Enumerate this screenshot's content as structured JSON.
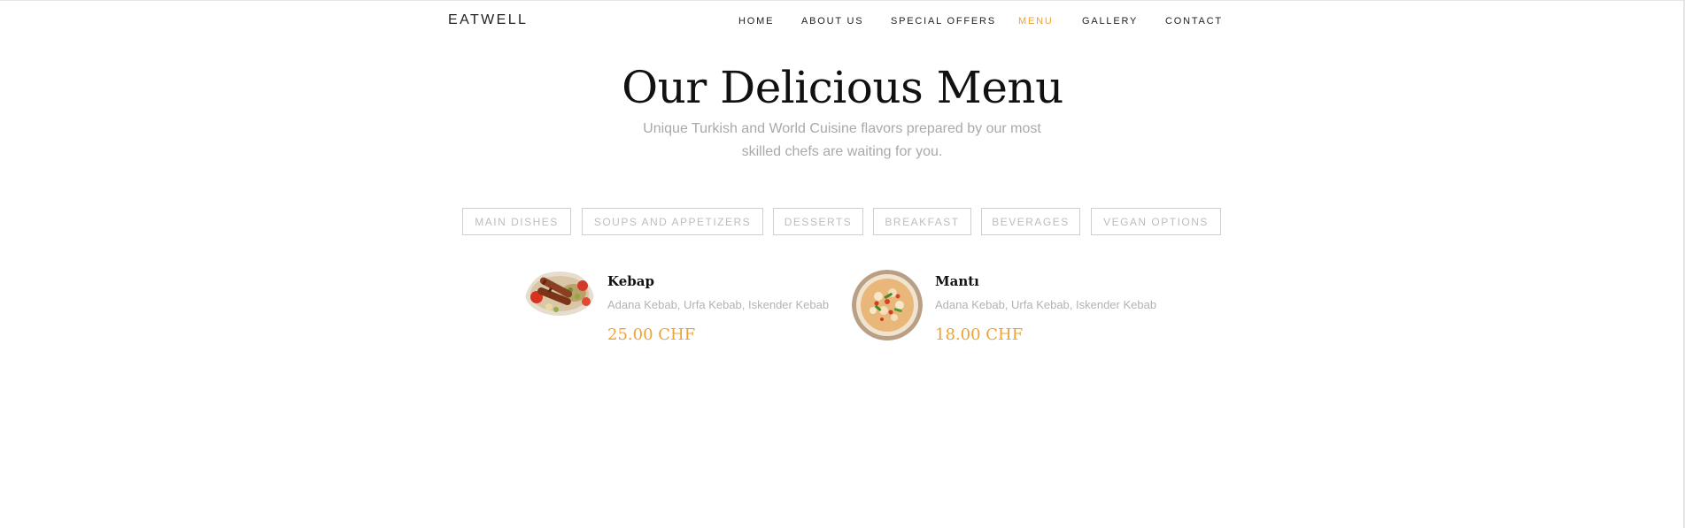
{
  "brand": "EATWELL",
  "nav": [
    {
      "label": "HOME",
      "active": false
    },
    {
      "label": "ABOUT US",
      "active": false
    },
    {
      "label": "SPECIAL OFFERS",
      "active": false
    },
    {
      "label": "MENU",
      "active": true
    },
    {
      "label": "GALLERY",
      "active": false
    },
    {
      "label": "CONTACT",
      "active": false
    }
  ],
  "hero": {
    "title": "Our Delicious Menu",
    "subtitle": "Unique Turkish and World Cuisine flavors prepared by our most skilled chefs are waiting for you."
  },
  "filters": [
    "MAIN DISHES",
    "SOUPS AND APPETIZERS",
    "DESSERTS",
    "BREAKFAST",
    "BEVERAGES",
    "VEGAN OPTIONS"
  ],
  "menu_items": [
    {
      "name": "Kebap",
      "description": "Adana Kebab, Urfa Kebab, Iskender Kebab",
      "price": "25.00 CHF",
      "image": "kebab-plate-photo"
    },
    {
      "name": "Mantı",
      "description": "Adana Kebab, Urfa Kebab, Iskender Kebab",
      "price": "18.00 CHF",
      "image": "manti-bowl-photo"
    }
  ],
  "colors": {
    "accent": "#f0a133",
    "text": "#111111",
    "muted": "#a9a9a9",
    "border": "#cfcfcf"
  }
}
